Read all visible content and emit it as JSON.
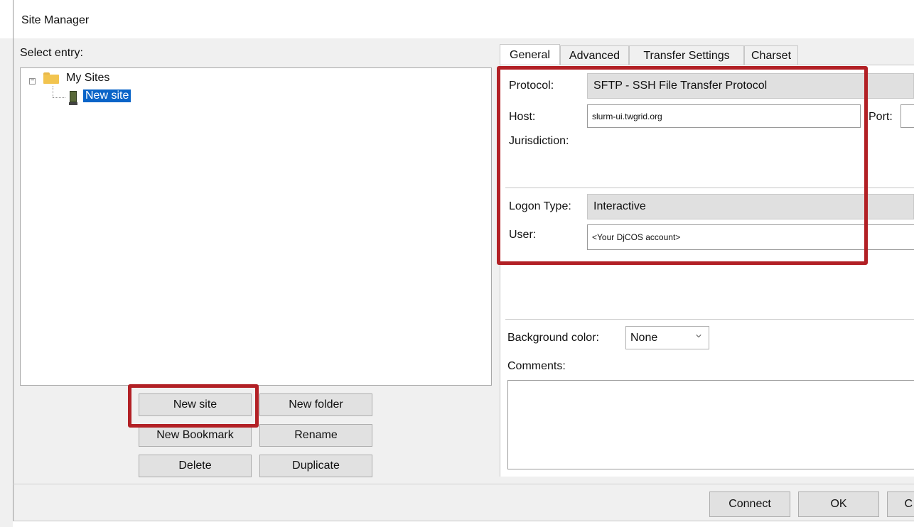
{
  "window": {
    "title": "Site Manager"
  },
  "left": {
    "select_entry_label": "Select entry:",
    "tree": {
      "root_label": "My Sites",
      "expander": "⊟",
      "children": [
        {
          "label": "New site",
          "selected": true
        }
      ]
    },
    "buttons": {
      "new_site": "New site",
      "new_folder": "New folder",
      "new_bookmark": "New Bookmark",
      "rename": "Rename",
      "delete": "Delete",
      "duplicate": "Duplicate"
    }
  },
  "tabs": [
    {
      "label": "General",
      "active": true
    },
    {
      "label": "Advanced",
      "active": false
    },
    {
      "label": "Transfer Settings",
      "active": false
    },
    {
      "label": "Charset",
      "active": false
    }
  ],
  "general": {
    "protocol_label": "Protocol:",
    "protocol_value": "SFTP - SSH File Transfer Protocol",
    "host_label": "Host:",
    "host_value": "slurm-ui.twgrid.org",
    "port_label": "Port:",
    "port_value": "",
    "jurisdiction_label": "Jurisdiction:",
    "logon_type_label": "Logon Type:",
    "logon_type_value": "Interactive",
    "user_label": "User:",
    "user_value": "<Your DjCOS account>",
    "background_color_label": "Background color:",
    "background_color_value": "None",
    "comments_label": "Comments:"
  },
  "footer": {
    "connect": "Connect",
    "ok": "OK",
    "cancel_partial": "C"
  },
  "colors": {
    "highlight_box": "#b22025",
    "selection": "#0a64c8",
    "folder": "#f2c44f"
  }
}
